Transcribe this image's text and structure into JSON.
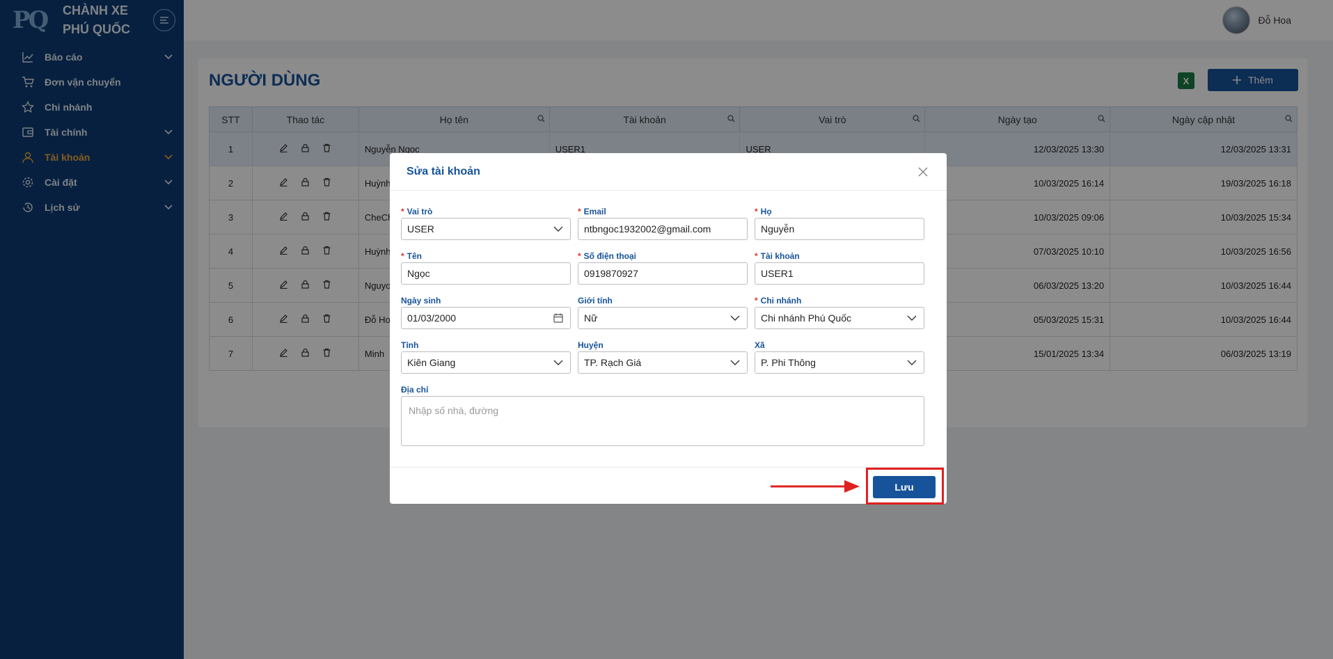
{
  "brand": {
    "logo_text": "PQ",
    "name_line1": "CHÀNH XE",
    "name_line2": "PHÚ QUỐC"
  },
  "sidebar": {
    "items": [
      {
        "label": "Báo cáo",
        "icon": "chart-line-icon",
        "has_children": true
      },
      {
        "label": "Đơn vận chuyển",
        "icon": "cart-icon",
        "has_children": false
      },
      {
        "label": "Chi nhánh",
        "icon": "star-icon",
        "has_children": false
      },
      {
        "label": "Tài chính",
        "icon": "wallet-icon",
        "has_children": true
      },
      {
        "label": "Tài khoản",
        "icon": "user-icon",
        "has_children": true,
        "active": true
      },
      {
        "label": "Cài đặt",
        "icon": "gear-icon",
        "has_children": true
      },
      {
        "label": "Lịch sử",
        "icon": "history-icon",
        "has_children": true
      }
    ]
  },
  "topbar": {
    "user_name": "Đỗ Hoa"
  },
  "page": {
    "title": "NGƯỜI DÙNG",
    "add_label": "Thêm",
    "excel_icon": "excel-icon"
  },
  "table": {
    "headers": [
      "STT",
      "Thao tác",
      "Họ tên",
      "Tài khoản",
      "Vai trò",
      "Ngày tạo",
      "Ngày cập nhật"
    ],
    "rows": [
      {
        "stt": "1",
        "name": "Nguyễn Ngọc",
        "account": "USER1",
        "role": "USER",
        "created": "12/03/2025 13:30",
        "updated": "12/03/2025 13:31"
      },
      {
        "stt": "2",
        "name": "Huỳnh",
        "account": "",
        "role": "",
        "created": "10/03/2025 16:14",
        "updated": "19/03/2025 16:18"
      },
      {
        "stt": "3",
        "name": "CheCh",
        "account": "",
        "role": "",
        "created": "10/03/2025 09:06",
        "updated": "10/03/2025 15:34"
      },
      {
        "stt": "4",
        "name": "Huỳnh",
        "account": "",
        "role": "",
        "created": "07/03/2025 10:10",
        "updated": "10/03/2025 16:56"
      },
      {
        "stt": "5",
        "name": "Nguyo",
        "account": "",
        "role": "",
        "created": "06/03/2025 13:20",
        "updated": "10/03/2025 16:44"
      },
      {
        "stt": "6",
        "name": "Đỗ Ho",
        "account": "",
        "role": "",
        "created": "05/03/2025 15:31",
        "updated": "10/03/2025 16:44"
      },
      {
        "stt": "7",
        "name": "Minh",
        "account": "",
        "role": "",
        "created": "15/01/2025 13:34",
        "updated": "06/03/2025 13:19"
      }
    ]
  },
  "modal": {
    "title": "Sửa tài khoản",
    "fields": {
      "role": {
        "label": "Vai trò",
        "value": "USER"
      },
      "email": {
        "label": "Email",
        "value": "ntbngoc1932002@gmail.com"
      },
      "last_name": {
        "label": "Họ",
        "value": "Nguyễn"
      },
      "first_name": {
        "label": "Tên",
        "value": "Ngọc"
      },
      "phone": {
        "label": "Số điện thoại",
        "value": "0919870927"
      },
      "account": {
        "label": "Tài khoản",
        "value": "USER1"
      },
      "dob": {
        "label": "Ngày sinh",
        "value": "01/03/2000"
      },
      "gender": {
        "label": "Giới tính",
        "value": "Nữ"
      },
      "branch": {
        "label": "Chi nhánh",
        "value": "Chi nhánh Phú Quốc"
      },
      "province": {
        "label": "Tỉnh",
        "value": "Kiên Giang"
      },
      "district": {
        "label": "Huyện",
        "value": "TP. Rạch Giá"
      },
      "ward": {
        "label": "Xã",
        "value": "P. Phi Thông"
      },
      "address": {
        "label": "Địa chỉ",
        "placeholder": "Nhập số nhà, đường"
      }
    },
    "save_label": "Lưu"
  },
  "colors": {
    "primary": "#17539a",
    "sidebar": "#0d3b73",
    "active": "#f2a93b",
    "required": "#e0302d",
    "highlight": "#e02020"
  }
}
